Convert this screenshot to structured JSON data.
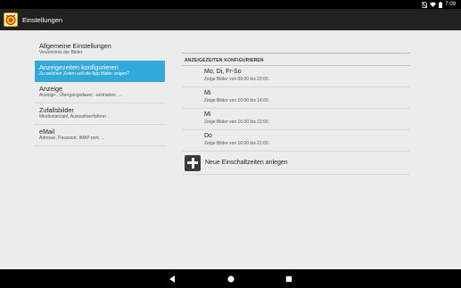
{
  "status_bar": {
    "time": "7:09"
  },
  "app_bar": {
    "title": "Einstellungen",
    "icon": "app-logo-icon"
  },
  "settings_list": [
    {
      "title": "Allgemeine Einstellungen",
      "subtitle": "Verzeichnis der Bilder"
    },
    {
      "title": "Anzeigezeiten konfigurieren",
      "subtitle": "Zu welchen Zeiten soll die App Bilder zeigen?"
    },
    {
      "title": "Anzeige",
      "subtitle": "Anzeige-, Übergangsdauer, -animation, ..."
    },
    {
      "title": "Zufallsbilder",
      "subtitle": "Mindestanzahl, Auswahlverfahren"
    },
    {
      "title": "eMail",
      "subtitle": "Adresse, Passwort, IMAP port, ..."
    }
  ],
  "right_pane": {
    "section_header": "ANZEIGEZEITEN KONFIGURIEREN",
    "time_items": [
      {
        "title": "Mo, Di, Fr-So",
        "subtitle": "Zeige Bilder von 08:00 bis 22:00."
      },
      {
        "title": "Mi",
        "subtitle": "Zeige Bilder von 10:00 bis 14:00."
      },
      {
        "title": "Mi",
        "subtitle": "Zeige Bilder von 16:00 bis 22:00."
      },
      {
        "title": "Do",
        "subtitle": "Zeige Bilder von 16:00 bis 21:00."
      }
    ],
    "add_label": "Neue Einschaltzeiten anlegen",
    "add_icon": "plus-icon"
  },
  "nav_bar": {
    "back_icon": "back-triangle-icon",
    "home_icon": "home-circle-icon",
    "recent_icon": "recent-square-icon"
  },
  "colors": {
    "accent": "#33a9d9",
    "app_bar": "#212121",
    "background": "#ececec"
  }
}
